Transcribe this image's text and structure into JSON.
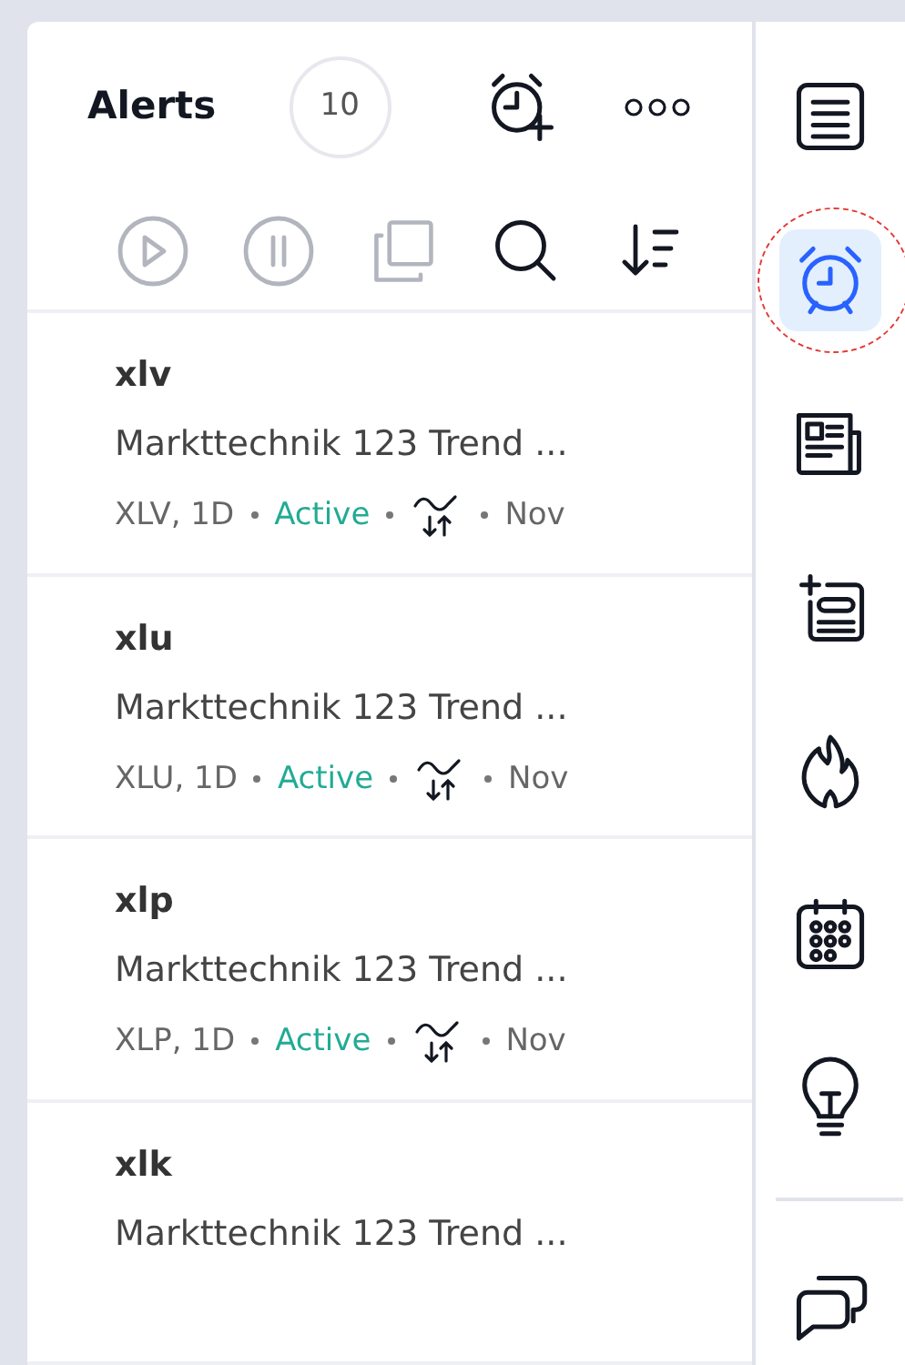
{
  "panel": {
    "title": "Alerts",
    "count": "10",
    "header_actions": [
      {
        "kind": "addalarm"
      },
      {
        "kind": "more"
      }
    ],
    "toolbar": [
      {
        "kind": "play",
        "disabled": true
      },
      {
        "kind": "pause",
        "disabled": true
      },
      {
        "kind": "copy",
        "disabled": true
      },
      {
        "kind": "search",
        "disabled": false
      },
      {
        "kind": "sort",
        "disabled": false
      }
    ],
    "alerts": [
      {
        "name": "xlv",
        "description": "Markttechnik 123 Trend ...",
        "symbol": "XLV, 1D",
        "status": "Active",
        "date": "Nov"
      },
      {
        "name": "xlu",
        "description": "Markttechnik 123 Trend ...",
        "symbol": "XLU, 1D",
        "status": "Active",
        "date": "Nov"
      },
      {
        "name": "xlp",
        "description": "Markttechnik 123 Trend ...",
        "symbol": "XLP, 1D",
        "status": "Active",
        "date": "Nov"
      },
      {
        "name": "xlk",
        "description": "Markttechnik 123 Trend ..."
      }
    ]
  },
  "sidebar": {
    "items": [
      {
        "kind": "watchlist",
        "selected": false,
        "circled": false
      },
      {
        "kind": "alarm",
        "selected": true,
        "circled": true
      },
      {
        "kind": "news",
        "selected": false,
        "circled": false
      },
      {
        "kind": "addlist",
        "selected": false,
        "circled": false
      },
      {
        "kind": "hot",
        "selected": false,
        "circled": false
      },
      {
        "kind": "calendar",
        "selected": false,
        "circled": false
      },
      {
        "kind": "ideas",
        "selected": false,
        "circled": false
      },
      {
        "kind": "divider"
      },
      {
        "kind": "chat",
        "selected": false,
        "circled": false
      }
    ]
  }
}
